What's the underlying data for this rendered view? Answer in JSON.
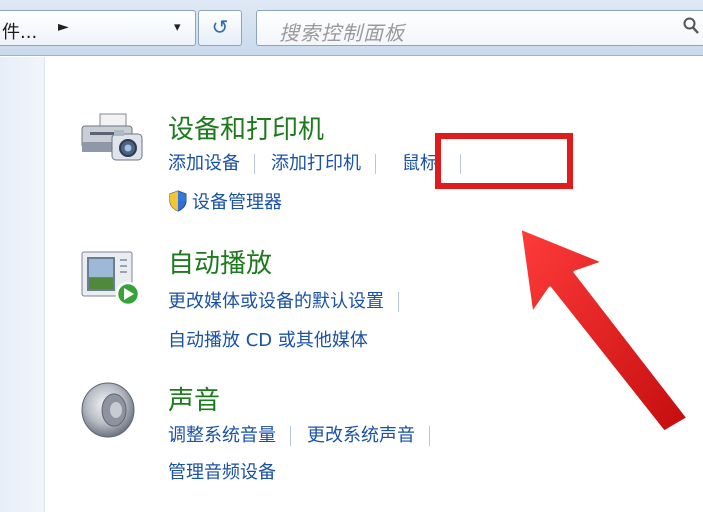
{
  "address_bar": {
    "path_text": "件...",
    "path_arrow": "►",
    "dropdown_arrow": "▾",
    "refresh_glyph": "↺"
  },
  "search": {
    "placeholder": "搜索控制面板",
    "icon": "search-icon"
  },
  "categories": [
    {
      "title": "设备和打印机",
      "icon": "printer-camera-icon",
      "links": [
        "添加设备",
        "添加打印机",
        "鼠标"
      ],
      "admin_link": "设备管理器"
    },
    {
      "title": "自动播放",
      "icon": "autoplay-icon",
      "links": [
        "更改媒体或设备的默认设置",
        "自动播放 CD 或其他媒体"
      ]
    },
    {
      "title": "声音",
      "icon": "speaker-icon",
      "links": [
        "调整系统音量",
        "更改系统声音",
        "管理音频设备"
      ]
    }
  ],
  "colors": {
    "title_green": "#1e7a1e",
    "link_blue": "#1a52a6",
    "highlight_red": "#e01b1b"
  }
}
